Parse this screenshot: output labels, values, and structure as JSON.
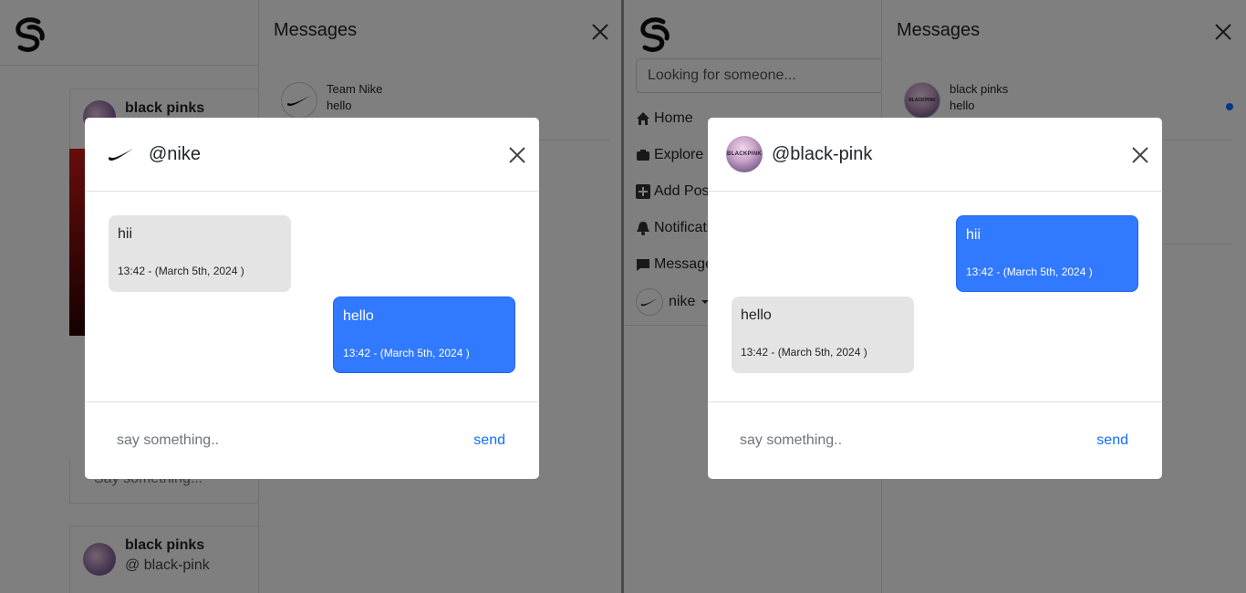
{
  "left": {
    "post1": {
      "name": "black pinks"
    },
    "post2": {
      "name": "black pinks",
      "handle": "@ black-pink"
    },
    "comment_placeholder": "Say something...",
    "messages_panel": {
      "title": "Messages",
      "conversation": {
        "name": "Team Nike",
        "last_message": "hello"
      }
    },
    "modal": {
      "handle": "@nike",
      "messages": [
        {
          "text": "hii",
          "time": "13:42 - (March 5th, 2024 )",
          "side": "left"
        },
        {
          "text": "hello",
          "time": "13:42 - (March 5th, 2024 )",
          "side": "right"
        }
      ],
      "input_placeholder": "say something..",
      "send_label": "send"
    }
  },
  "right": {
    "search_placeholder": "Looking for someone...",
    "nav": {
      "home": "Home",
      "explore": "Explore",
      "add_post": "Add Post",
      "notifications": "Notifications",
      "messages": "Messages",
      "user": "nike"
    },
    "messages_panel": {
      "title": "Messages",
      "conversation": {
        "name": "black pinks",
        "last_message": "hello",
        "avatar_text": "BLACKPINK"
      }
    },
    "modal": {
      "handle": "@black-pink",
      "avatar_text": "BLACKPINK",
      "messages": [
        {
          "text": "hii",
          "time": "13:42 - (March 5th, 2024 )",
          "side": "right"
        },
        {
          "text": "hello",
          "time": "13:42 - (March 5th, 2024 )",
          "side": "left"
        }
      ],
      "input_placeholder": "say something..",
      "send_label": "send"
    }
  },
  "colors": {
    "accent": "#3179ff",
    "link": "#0d6efd",
    "bubble_grey": "#e4e4e4",
    "backdrop": "rgba(0,0,0,0.5)"
  },
  "icons": [
    "app-logo-icon",
    "close-icon",
    "nike-swoosh-icon",
    "home-icon",
    "explore-icon",
    "add-post-icon",
    "bell-icon",
    "message-icon",
    "caret-down-icon"
  ]
}
